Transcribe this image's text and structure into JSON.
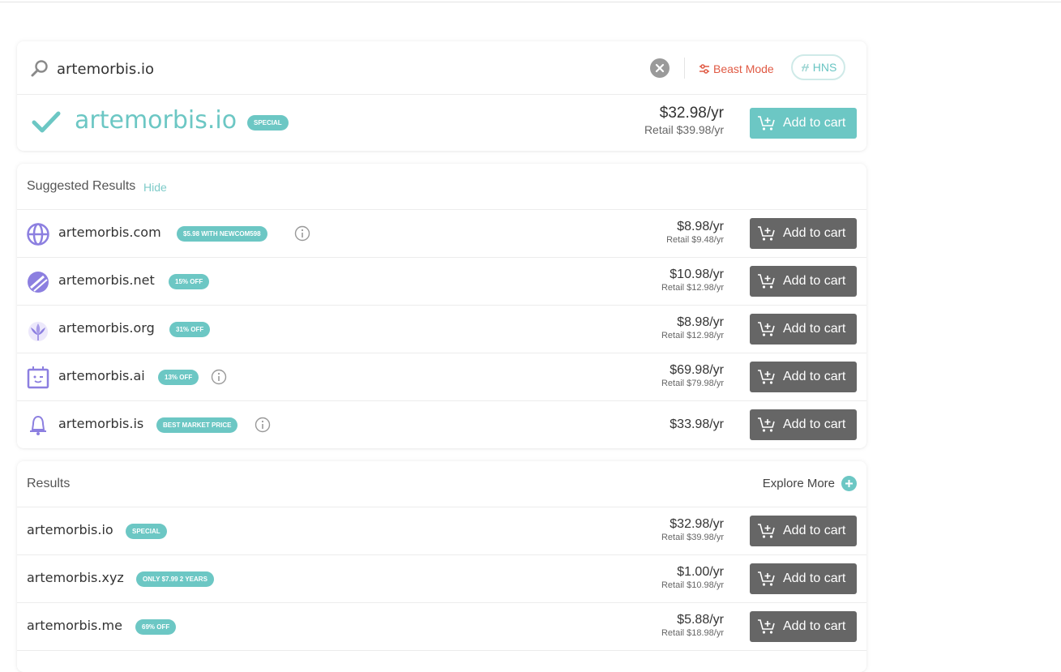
{
  "search": {
    "query": "artemorbis.io",
    "beast_mode_label": "Beast Mode",
    "hns_label": "HNS"
  },
  "featured": {
    "domain": "artemorbis.io",
    "badge": "SPECIAL",
    "price": "$32.98/yr",
    "retail": "Retail $39.98/yr",
    "cart_label": "Add to cart"
  },
  "suggested": {
    "title": "Suggested Results",
    "hide_label": "Hide",
    "rows": [
      {
        "domain": "artemorbis.com",
        "badge": "$5.98 WITH NEWCOM598",
        "price": "$8.98/yr",
        "retail": "Retail $9.48/yr",
        "icon": "globe-icon",
        "cart_label": "Add to cart"
      },
      {
        "domain": "artemorbis.net",
        "badge": "15% OFF",
        "price": "$10.98/yr",
        "retail": "Retail $12.98/yr",
        "icon": "net-leaf-icon",
        "cart_label": "Add to cart"
      },
      {
        "domain": "artemorbis.org",
        "badge": "31% OFF",
        "price": "$8.98/yr",
        "retail": "Retail $12.98/yr",
        "icon": "lotus-icon",
        "cart_label": "Add to cart"
      },
      {
        "domain": "artemorbis.ai",
        "badge": "13% OFF",
        "price": "$69.98/yr",
        "retail": "Retail $79.98/yr",
        "icon": "robot-face-icon",
        "cart_label": "Add to cart"
      },
      {
        "domain": "artemorbis.is",
        "badge": "BEST MARKET PRICE",
        "price": "$33.98/yr",
        "retail": "",
        "icon": "bell-icon",
        "cart_label": "Add to cart"
      }
    ]
  },
  "results": {
    "title": "Results",
    "explore_label": "Explore More",
    "rows": [
      {
        "domain": "artemorbis.io",
        "badge": "SPECIAL",
        "price": "$32.98/yr",
        "retail": "Retail $39.98/yr",
        "cart_label": "Add to cart"
      },
      {
        "domain": "artemorbis.xyz",
        "badge": "ONLY $7.99 2 YEARS",
        "price": "$1.00/yr",
        "retail": "Retail $10.98/yr",
        "cart_label": "Add to cart"
      },
      {
        "domain": "artemorbis.me",
        "badge": "69% OFF",
        "price": "$5.88/yr",
        "retail": "Retail $18.98/yr",
        "cart_label": "Add to cart"
      }
    ]
  },
  "colors": {
    "accent_teal": "#6cc7c4",
    "beast_red": "#e05a44",
    "button_gray": "#666666"
  }
}
